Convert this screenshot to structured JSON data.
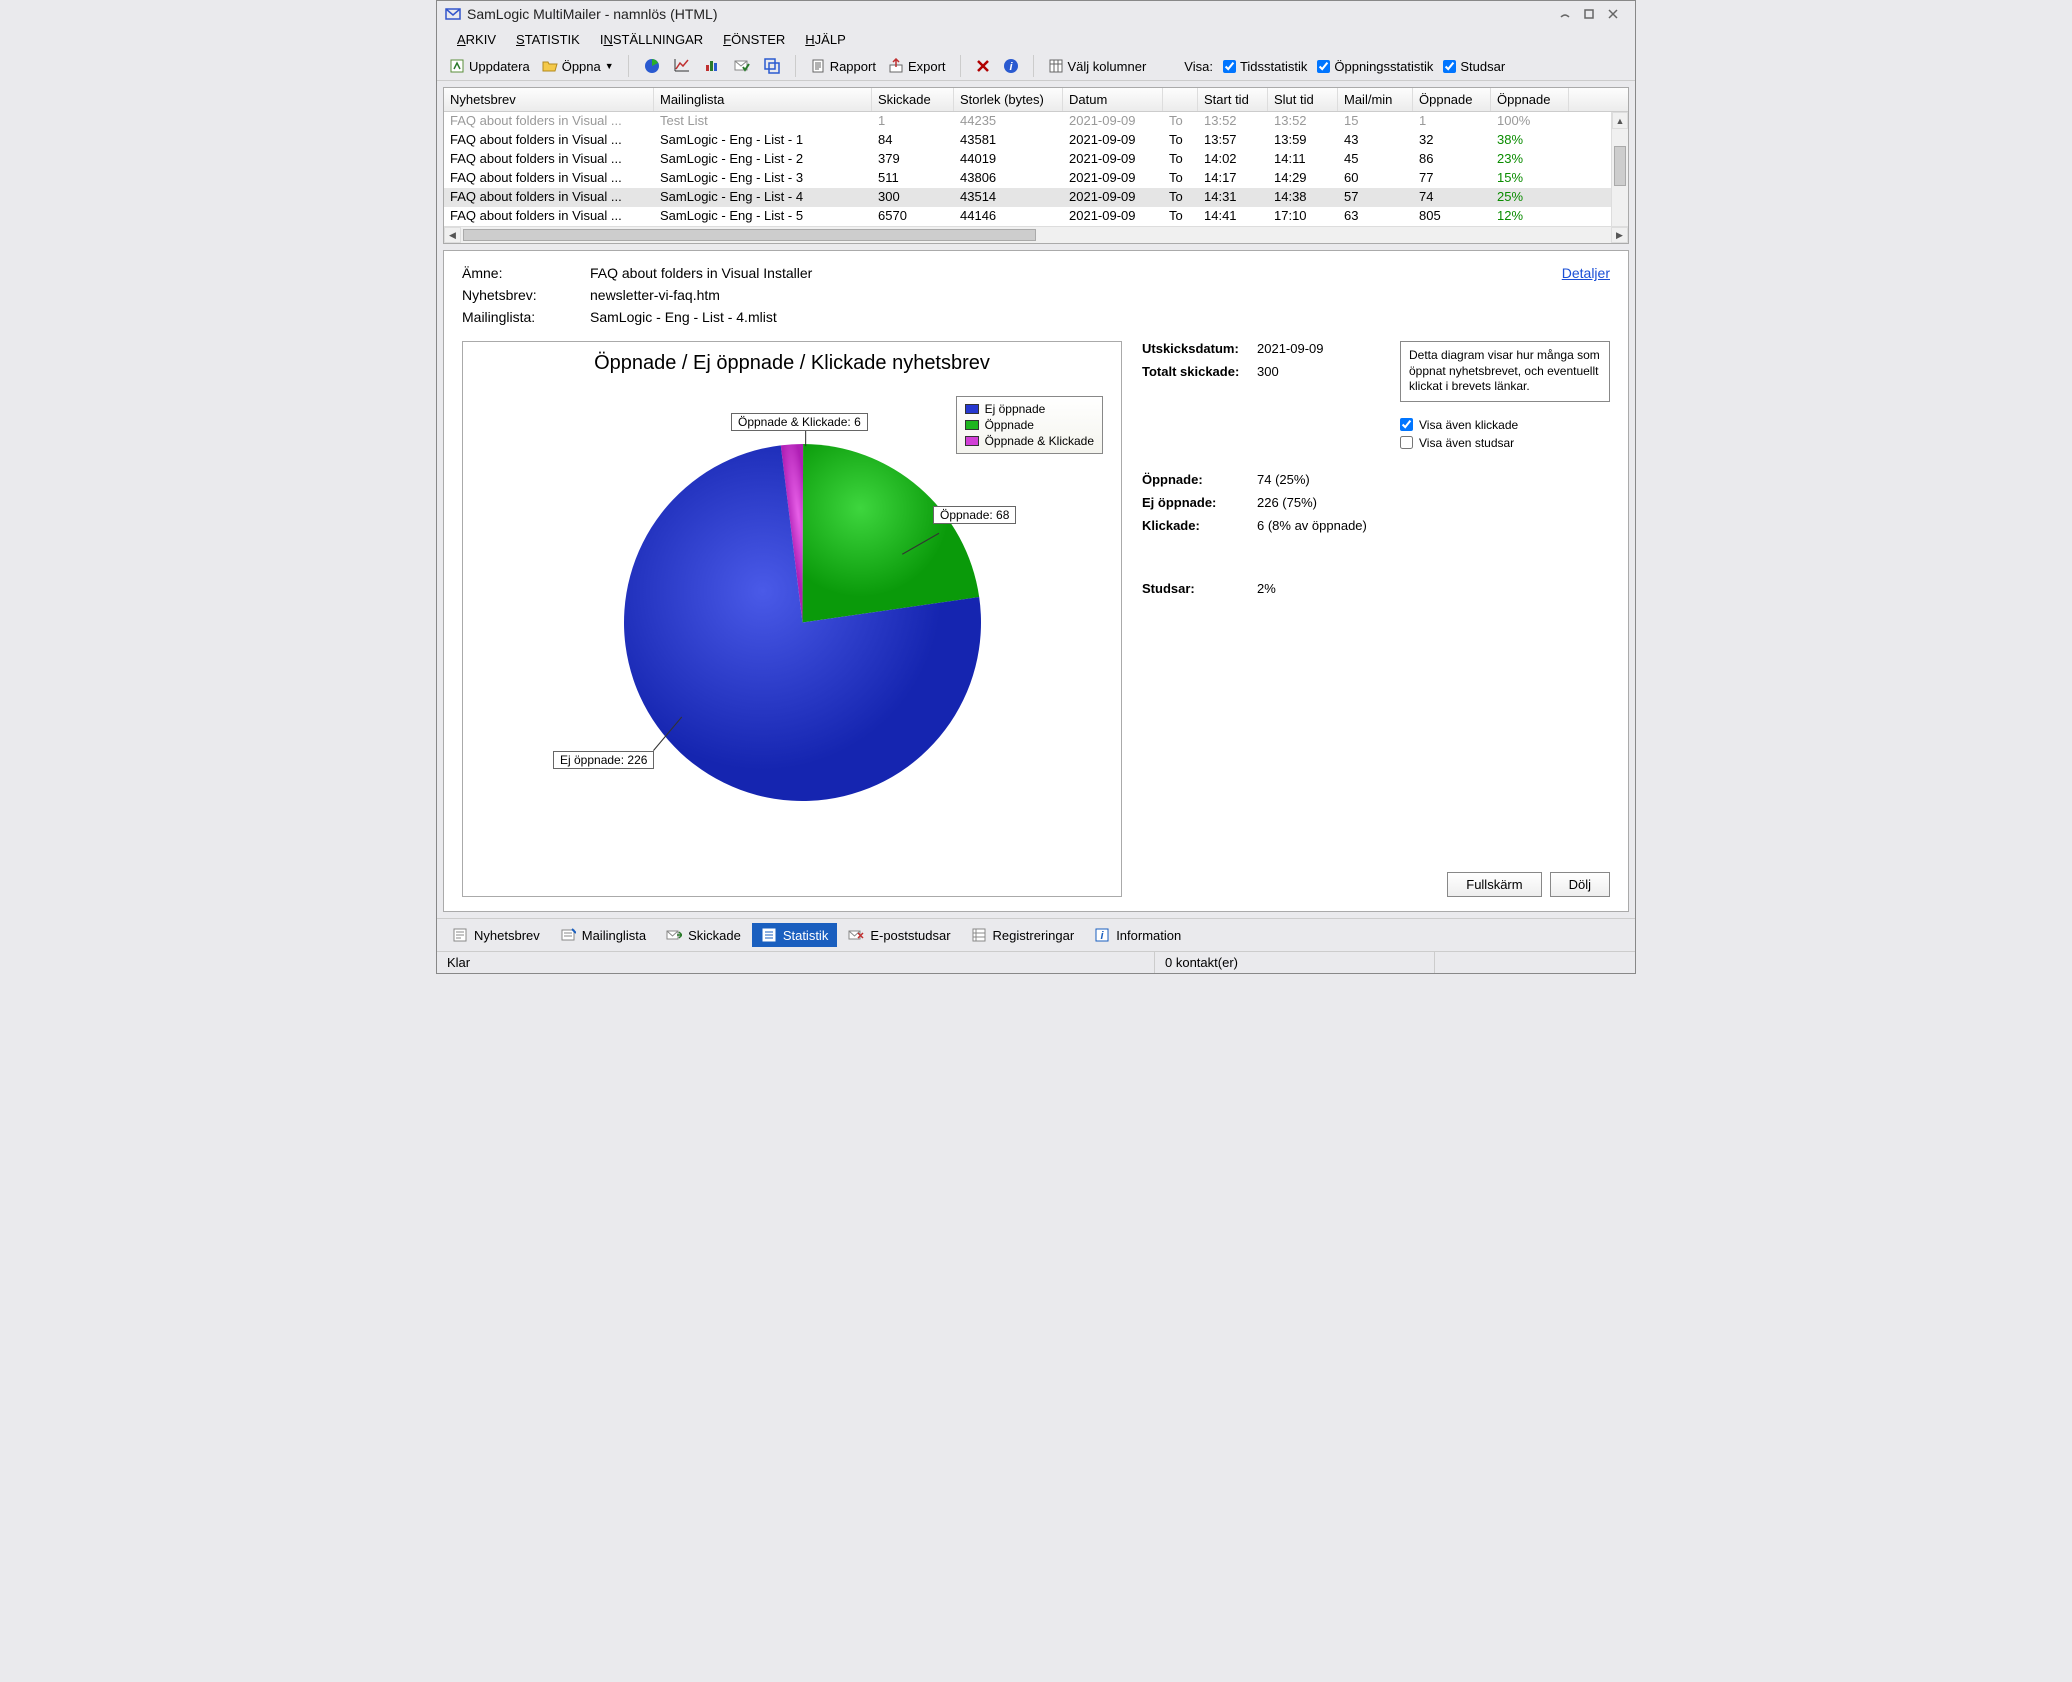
{
  "window_title": "SamLogic MultiMailer - namnlös  (HTML)",
  "menu": {
    "arkiv": "ARKIV",
    "statistik": "STATISTIK",
    "installningar": "INSTÄLLNINGAR",
    "fonster": "FÖNSTER",
    "hjalp": "HJÄLP"
  },
  "toolbar": {
    "uppdatera": "Uppdatera",
    "oppna": "Öppna",
    "rapport": "Rapport",
    "export": "Export",
    "valj_kolumner": "Välj kolumner",
    "visa_label": "Visa:",
    "tidsstatistik": "Tidsstatistik",
    "oppningsstatistik": "Öppningsstatistik",
    "studsar": "Studsar"
  },
  "columns": [
    "Nyhetsbrev",
    "Mailinglista",
    "Skickade",
    "Storlek (bytes)",
    "Datum",
    "",
    "Start tid",
    "Slut tid",
    "Mail/min",
    "Öppnade",
    "Öppnade"
  ],
  "rows": [
    {
      "n": "FAQ about folders in Visual ...",
      "m": "Test List",
      "s": "1",
      "b": "44235",
      "d": "2021-09-09",
      "t": "To",
      "st": "13:52",
      "et": "13:52",
      "mm": "15",
      "o": "1",
      "op": "100%",
      "dis": true
    },
    {
      "n": "FAQ about folders in Visual ...",
      "m": "SamLogic - Eng - List - 1",
      "s": "84",
      "b": "43581",
      "d": "2021-09-09",
      "t": "To",
      "st": "13:57",
      "et": "13:59",
      "mm": "43",
      "o": "32",
      "op": "38%"
    },
    {
      "n": "FAQ about folders in Visual ...",
      "m": "SamLogic - Eng - List - 2",
      "s": "379",
      "b": "44019",
      "d": "2021-09-09",
      "t": "To",
      "st": "14:02",
      "et": "14:11",
      "mm": "45",
      "o": "86",
      "op": "23%"
    },
    {
      "n": "FAQ about folders in Visual ...",
      "m": "SamLogic - Eng - List - 3",
      "s": "511",
      "b": "43806",
      "d": "2021-09-09",
      "t": "To",
      "st": "14:17",
      "et": "14:29",
      "mm": "60",
      "o": "77",
      "op": "15%"
    },
    {
      "n": "FAQ about folders in Visual ...",
      "m": "SamLogic - Eng - List - 4",
      "s": "300",
      "b": "43514",
      "d": "2021-09-09",
      "t": "To",
      "st": "14:31",
      "et": "14:38",
      "mm": "57",
      "o": "74",
      "op": "25%",
      "sel": true
    },
    {
      "n": "FAQ about folders in Visual ...",
      "m": "SamLogic - Eng - List - 5",
      "s": "6570",
      "b": "44146",
      "d": "2021-09-09",
      "t": "To",
      "st": "14:41",
      "et": "17:10",
      "mm": "63",
      "o": "805",
      "op": "12%"
    }
  ],
  "detail": {
    "amne_label": "Ämne:",
    "amne": "FAQ about folders in Visual Installer",
    "nyhetsbrev_label": "Nyhetsbrev:",
    "nyhetsbrev": "newsletter-vi-faq.htm",
    "mailing_label": "Mailinglista:",
    "mailing": "SamLogic - Eng - List - 4.mlist",
    "detaljer": "Detaljer"
  },
  "chart_data": {
    "type": "pie",
    "title": "Öppnade / Ej öppnade / Klickade nyhetsbrev",
    "series": [
      {
        "name": "Ej öppnade",
        "value": 226,
        "color": "#2638d0"
      },
      {
        "name": "Öppnade",
        "value": 68,
        "color": "#1fb51f"
      },
      {
        "name": "Öppnade & Klickade",
        "value": 6,
        "color": "#d13fd6"
      }
    ],
    "callouts": {
      "klick": "Öppnade & Klickade: 6",
      "open": "Öppnade: 68",
      "closed": "Ej öppnade: 226"
    },
    "legend": [
      "Ej öppnade",
      "Öppnade",
      "Öppnade & Klickade"
    ]
  },
  "stats": {
    "utskick_label": "Utskicksdatum:",
    "utskick": "2021-09-09",
    "totalt_label": "Totalt skickade:",
    "totalt": "300",
    "oppnade_label": "Öppnade:",
    "oppnade": "74  (25%)",
    "ej_label": "Ej öppnade:",
    "ej": "226  (75%)",
    "klick_label": "Klickade:",
    "klick": "6  (8% av öppnade)",
    "studsar_label": "Studsar:",
    "studsar": "2%",
    "desc": "Detta diagram visar hur många som öppnat nyhetsbrevet, och eventuellt klickat i brevets länkar.",
    "visa_klick": "Visa även klickade",
    "visa_studs": "Visa även studsar",
    "fullskarm": "Fullskärm",
    "dolj": "Dölj"
  },
  "bottom": {
    "nyhetsbrev": "Nyhetsbrev",
    "mailinglista": "Mailinglista",
    "skickade": "Skickade",
    "statistik": "Statistik",
    "epoststudsar": "E-poststudsar",
    "registreringar": "Registreringar",
    "information": "Information"
  },
  "status": {
    "left": "Klar",
    "mid": "0 kontakt(er)"
  }
}
